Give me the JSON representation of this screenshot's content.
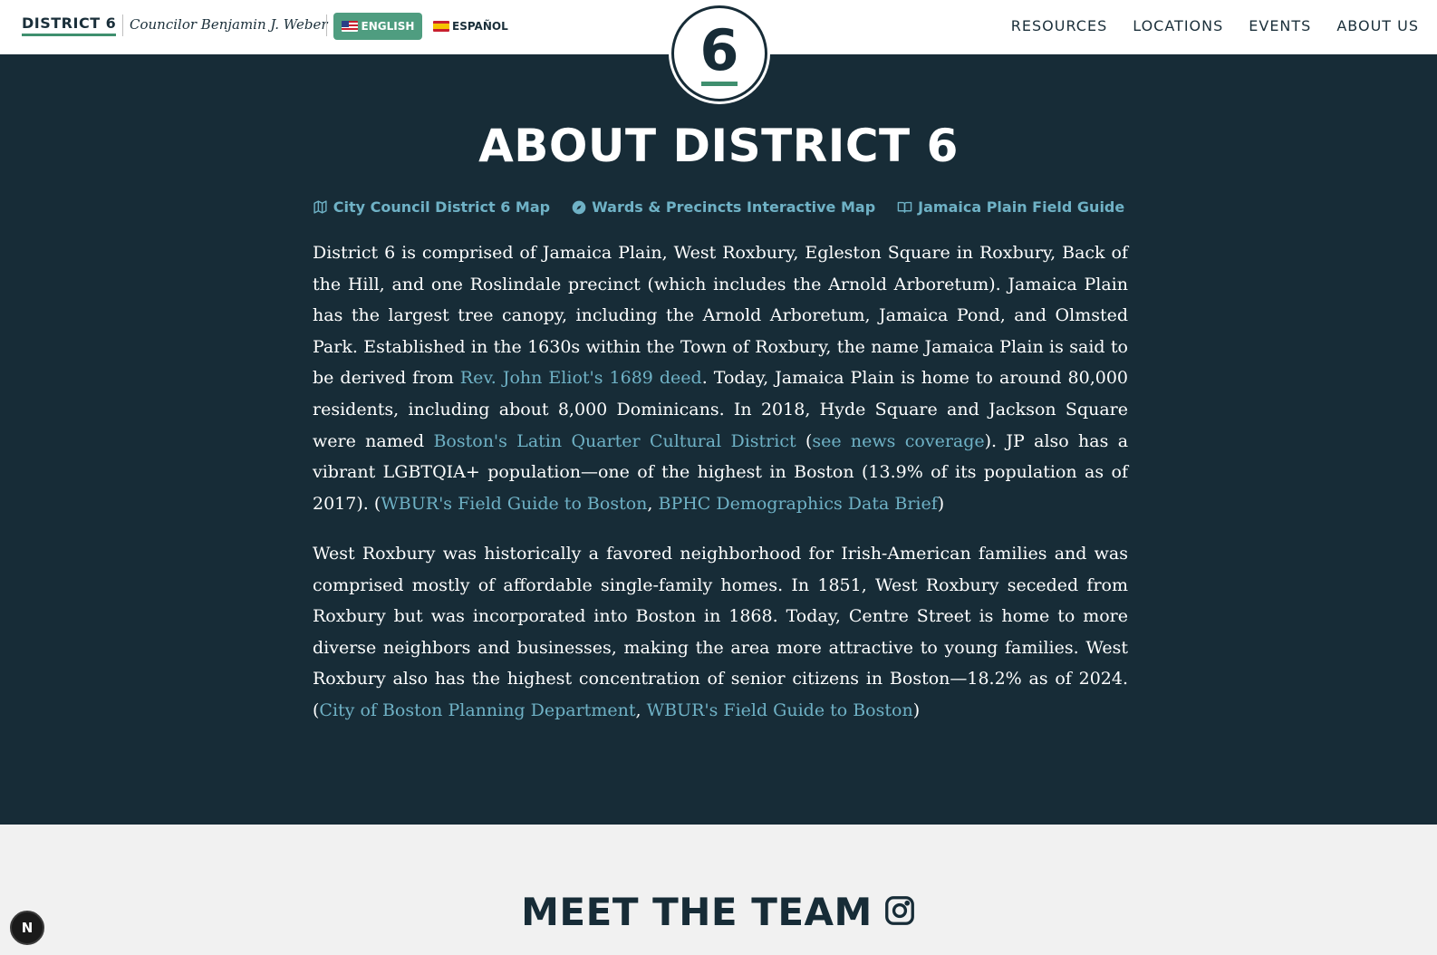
{
  "header": {
    "brand": "DISTRICT 6",
    "councilor": "Councilor Benjamin J. Weber",
    "lang_en": "ENGLISH",
    "lang_es": "ESPAÑOL",
    "nav": [
      "RESOURCES",
      "LOCATIONS",
      "EVENTS",
      "ABOUT US"
    ],
    "logo_digit": "6"
  },
  "about": {
    "title": "ABOUT DISTRICT 6",
    "quick_links": [
      {
        "label": "City Council District 6 Map",
        "icon": "map-icon"
      },
      {
        "label": "Wards & Precincts Interactive Map",
        "icon": "compass-icon"
      },
      {
        "label": "Jamaica Plain Field Guide",
        "icon": "book-icon"
      }
    ],
    "p1": {
      "t1": "District 6 is comprised of Jamaica Plain, West Roxbury, Egleston Square in Roxbury, Back of the Hill, and one Roslindale precinct (which includes the Arnold Arboretum). Jamaica Plain has the largest tree canopy, including the Arnold Arboretum, Jamaica Pond, and Olmsted Park. Established in the 1630s within the Town of Roxbury, the name Jamaica Plain is said to be derived from ",
      "link1": "Rev. John Eliot's 1689 deed",
      "t2": ". Today, Jamaica Plain is home to around 80,000 residents, including about 8,000 Dominicans. In 2018, Hyde Square and Jackson Square were named ",
      "link2": "Boston's Latin Quarter Cultural District",
      "t3": " (",
      "link3": "see news coverage",
      "t4": "). JP also has a vibrant LGBTQIA+ population—one of the highest in Boston (13.9% of its population as of 2017). (",
      "link4": "WBUR's Field Guide to Boston",
      "t5": ", ",
      "link5": "BPHC Demographics Data Brief",
      "t6": ")"
    },
    "p2": {
      "t1": "West Roxbury was historically a favored neighborhood for Irish-American families and was comprised mostly of affordable single-family homes. In 1851, West Roxbury seceded from Roxbury but was incorporated into Boston in 1868. Today, Centre Street is home to more diverse neighbors and businesses, making the area more attractive to young families. West Roxbury also has the highest concentration of senior citizens in Boston—18.2% as of 2024. (",
      "link1": "City of Boston Planning Department",
      "t2": ", ",
      "link2": "WBUR's Field Guide to Boston",
      "t3": ")"
    }
  },
  "team": {
    "title": "MEET THE TEAM",
    "icon": "instagram-icon"
  },
  "dev_badge": "N",
  "colors": {
    "dark_bg": "#172c37",
    "accent_green": "#4f9d80",
    "link_blue": "#6fb2c6",
    "light_bg": "#f1f1f1"
  }
}
